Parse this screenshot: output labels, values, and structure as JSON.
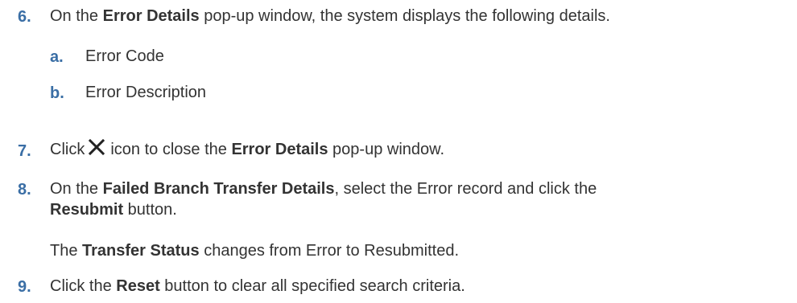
{
  "steps": [
    {
      "num": "6.",
      "parts": [
        "On the ",
        "Error Details",
        " pop-up window, the system displays the following details."
      ],
      "substeps": [
        {
          "num": "a.",
          "text": "Error Code"
        },
        {
          "num": "b.",
          "text": "Error Description"
        }
      ]
    },
    {
      "num": "7.",
      "parts": [
        "Click",
        "icon to close the ",
        "Error Details",
        " pop-up window."
      ],
      "icon": "close-x-icon"
    },
    {
      "num": "8.",
      "parts": [
        "On the ",
        "Failed Branch Transfer Details",
        ", select the Error record and click the",
        "Resubmit",
        " button."
      ],
      "note_parts": [
        "The ",
        "Transfer Status",
        " changes from Error to Resubmitted."
      ]
    },
    {
      "num": "9.",
      "parts": [
        "Click the ",
        "Reset",
        " button to clear all specified search criteria."
      ]
    }
  ],
  "colors": {
    "number": "#3a6ea5",
    "text": "#333333"
  }
}
